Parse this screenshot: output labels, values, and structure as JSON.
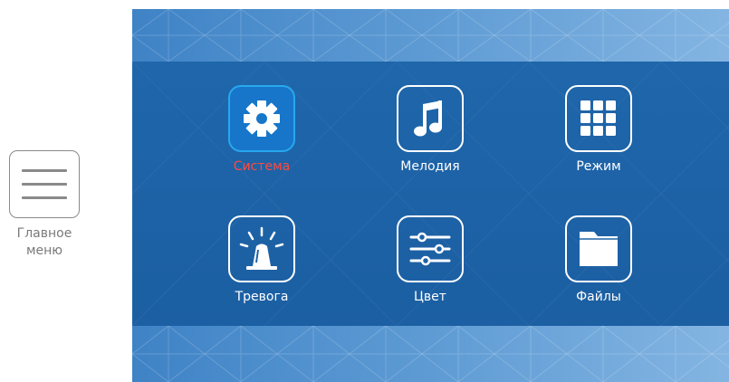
{
  "side_button": {
    "label": "Главное\nменю",
    "icon": "hamburger-menu-icon"
  },
  "menu": {
    "items": [
      {
        "label": "Система",
        "icon": "gear-icon",
        "selected": true
      },
      {
        "label": "Мелодия",
        "icon": "music-note-icon",
        "selected": false
      },
      {
        "label": "Режим",
        "icon": "grid-icon",
        "selected": false
      },
      {
        "label": "Тревога",
        "icon": "alarm-siren-icon",
        "selected": false
      },
      {
        "label": "Цвет",
        "icon": "sliders-icon",
        "selected": false
      },
      {
        "label": "Файлы",
        "icon": "folder-icon",
        "selected": false
      }
    ]
  },
  "colors": {
    "selected_label": "#ff4a3c",
    "selected_frame": "#27a8ef",
    "panel": "#1e63a6",
    "band": "#5e9bd4"
  }
}
